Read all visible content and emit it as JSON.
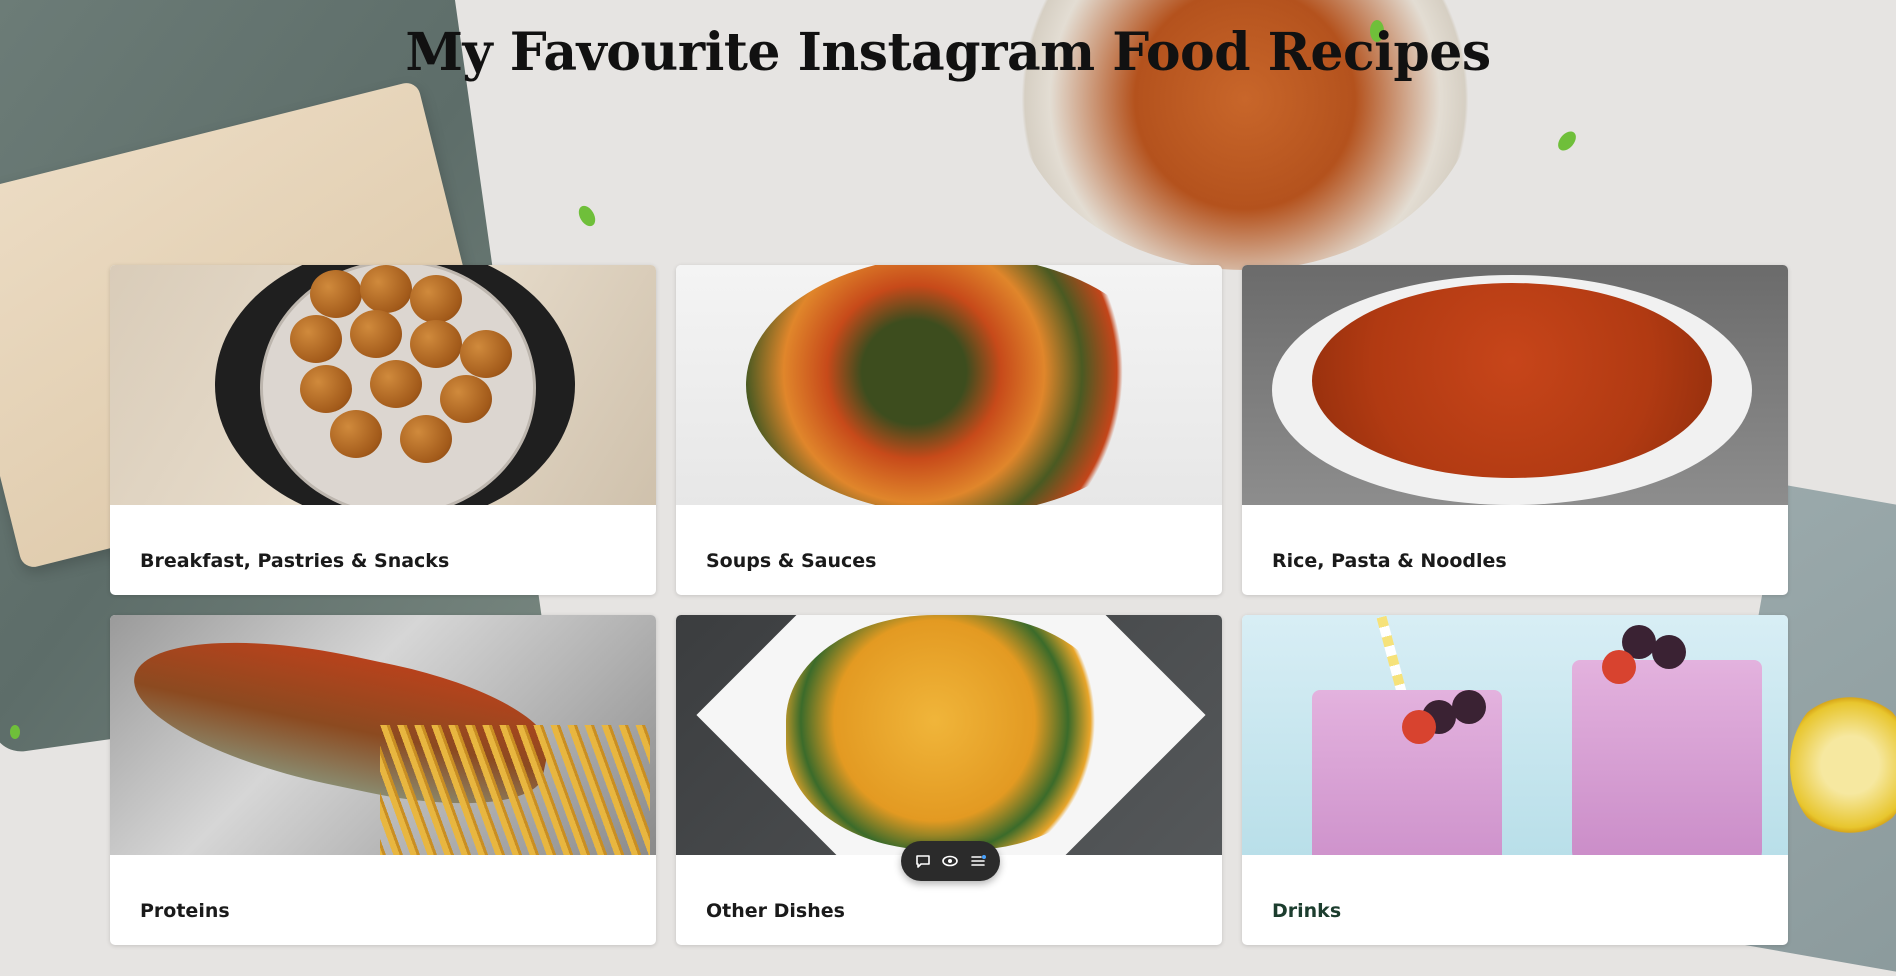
{
  "page": {
    "title": "My Favourite Instagram Food Recipes"
  },
  "categories": [
    {
      "label": "Breakfast, Pastries & Snacks",
      "image": "puff-puff-bowl"
    },
    {
      "label": "Soups & Sauces",
      "image": "vegetable-soup"
    },
    {
      "label": "Rice, Pasta & Noodles",
      "image": "jollof-rice"
    },
    {
      "label": "Proteins",
      "image": "grilled-fish-fries"
    },
    {
      "label": "Other Dishes",
      "image": "yam-porridge"
    },
    {
      "label": "Drinks",
      "image": "berry-smoothies"
    }
  ],
  "toolbar": {
    "icons": [
      "comment-icon",
      "eye-icon",
      "menu-list-icon"
    ]
  },
  "colors": {
    "background": "#e6e4e2",
    "card": "#ffffff",
    "toolbar": "#2b2b2b",
    "drinks_label": "#1c3d2e"
  }
}
